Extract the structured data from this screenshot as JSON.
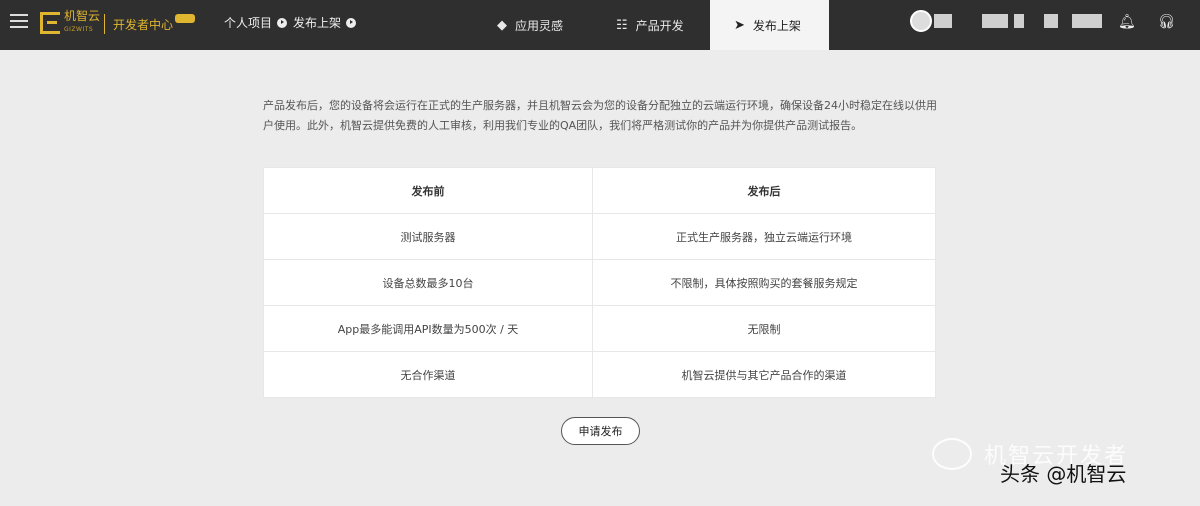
{
  "header": {
    "logo_text": "机智云",
    "logo_sub": "GIZWITS",
    "dev_center": "开发者中心",
    "breadcrumbs": [
      "个人项目",
      "发布上架"
    ],
    "nav": [
      {
        "label": "应用灵感",
        "icon": "diamond-icon"
      },
      {
        "label": "产品开发",
        "icon": "sliders-icon"
      },
      {
        "label": "发布上架",
        "icon": "send-icon",
        "active": true
      }
    ]
  },
  "main": {
    "intro": "产品发布后，您的设备将会运行在正式的生产服务器，并且机智云会为您的设备分配独立的云端运行环境，确保设备24小时稳定在线以供用户使用。此外，机智云提供免费的人工审核，利用我们专业的QA团队，我们将严格测试你的产品并为你提供产品测试报告。",
    "table": {
      "headers": [
        "发布前",
        "发布后"
      ],
      "rows": [
        [
          "测试服务器",
          "正式生产服务器，独立云端运行环境"
        ],
        [
          "设备总数最多10台",
          "不限制，具体按照购买的套餐服务规定"
        ],
        [
          "App最多能调用API数量为500次 / 天",
          "无限制"
        ],
        [
          "无合作渠道",
          "机智云提供与其它产品合作的渠道"
        ]
      ]
    },
    "apply_button": "申请发布"
  },
  "watermark": {
    "faded": "机智云开发者",
    "main": "头条 @机智云"
  }
}
